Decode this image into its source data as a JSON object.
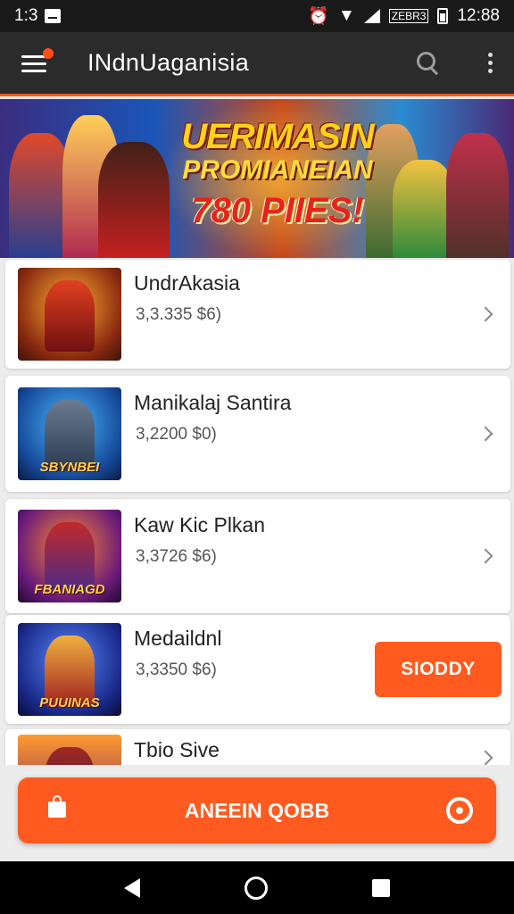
{
  "status_bar": {
    "time_left": "1:3",
    "time_right": "12:88",
    "battery_label": "ZEBR3"
  },
  "app_bar": {
    "title": "INdnUaganisia",
    "icons": [
      "menu-icon",
      "search-icon",
      "more-vert-icon"
    ]
  },
  "banner": {
    "line1": "UERIMASIN",
    "line2": "PROMIANEIAN",
    "line3": "780 PIIES!"
  },
  "games": [
    {
      "title": "UndrAkasia",
      "subtitle": "3,3.335 $6)",
      "thumb_caption": "",
      "action": "chevron"
    },
    {
      "title": "Manikalaj Santira",
      "subtitle": "3,2200 $0)",
      "thumb_caption": "SBYNBEI",
      "action": "chevron"
    },
    {
      "title": "Kaw Kic Plkan",
      "subtitle": "3,3726 $6)",
      "thumb_caption": "FBANIAGD",
      "action": "chevron"
    },
    {
      "title": "Medaildnl",
      "subtitle": "3,3350 $6)",
      "thumb_caption": "PUUINAS",
      "action": "button",
      "button_label": "SIODDY"
    },
    {
      "title": "Tbio Sive",
      "subtitle": "",
      "thumb_caption": "",
      "action": "chevron"
    }
  ],
  "cta": {
    "label": "ANEEIN QOBB"
  },
  "colors": {
    "accent": "#ff5a1f",
    "app_bar_bg": "#2b2b2b",
    "status_bar_bg": "#1a1a1a"
  }
}
